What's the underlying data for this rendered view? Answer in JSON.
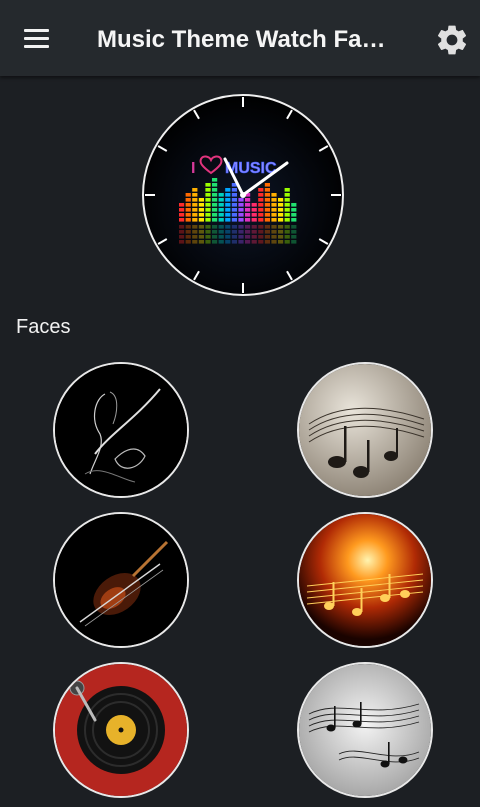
{
  "appbar": {
    "title": "Music Theme Watch Fa…",
    "menu_icon": "hamburger-menu-icon",
    "settings_icon": "gear-icon"
  },
  "preview": {
    "logo_text": "MUSIC",
    "heart_prefix": "I"
  },
  "section": {
    "faces_label": "Faces"
  },
  "faces": [
    {
      "name": "guitarist"
    },
    {
      "name": "music-notes-sepia"
    },
    {
      "name": "violin"
    },
    {
      "name": "fiery-notes"
    },
    {
      "name": "record-player"
    },
    {
      "name": "music-notes-white"
    }
  ],
  "colors": {
    "background": "#1c1f23",
    "appbar": "#25292d",
    "text": "#f5f5f5"
  }
}
